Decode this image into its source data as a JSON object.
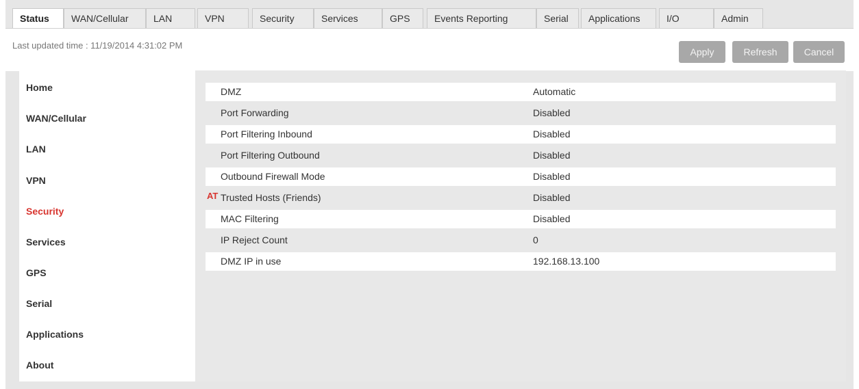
{
  "tabs": [
    {
      "label": "Status",
      "active": true
    },
    {
      "label": "WAN/Cellular"
    },
    {
      "label": "LAN"
    },
    {
      "label": "VPN"
    },
    {
      "label": "Security"
    },
    {
      "label": "Services"
    },
    {
      "label": "GPS"
    },
    {
      "label": "Events Reporting"
    },
    {
      "label": "Serial"
    },
    {
      "label": "Applications"
    },
    {
      "label": "I/O"
    },
    {
      "label": "Admin"
    }
  ],
  "header": {
    "last_updated": "Last updated time : 11/19/2014 4:31:02 PM",
    "apply_label": "Apply",
    "refresh_label": "Refresh",
    "cancel_label": "Cancel"
  },
  "sidebar": {
    "items": [
      {
        "label": "Home"
      },
      {
        "label": "WAN/Cellular"
      },
      {
        "label": "LAN"
      },
      {
        "label": "VPN"
      },
      {
        "label": "Security",
        "active": true
      },
      {
        "label": "Services"
      },
      {
        "label": "GPS"
      },
      {
        "label": "Serial"
      },
      {
        "label": "Applications"
      },
      {
        "label": "About"
      }
    ]
  },
  "table": {
    "rows": [
      {
        "label": "DMZ",
        "value": "Automatic"
      },
      {
        "label": "Port Forwarding",
        "value": "Disabled"
      },
      {
        "label": "Port Filtering Inbound",
        "value": "Disabled"
      },
      {
        "label": "Port Filtering Outbound",
        "value": "Disabled"
      },
      {
        "label": "Outbound Firewall Mode",
        "value": "Disabled"
      },
      {
        "label": "Trusted Hosts (Friends)",
        "value": "Disabled",
        "badge": "AT"
      },
      {
        "label": "MAC Filtering",
        "value": "Disabled"
      },
      {
        "label": "IP Reject Count",
        "value": "0"
      },
      {
        "label": "DMZ IP in use",
        "value": "192.168.13.100"
      }
    ]
  },
  "colors": {
    "accent": "#d8352f",
    "button_disabled": "#a8a8a8",
    "panel_bg": "#e8e8e8"
  }
}
